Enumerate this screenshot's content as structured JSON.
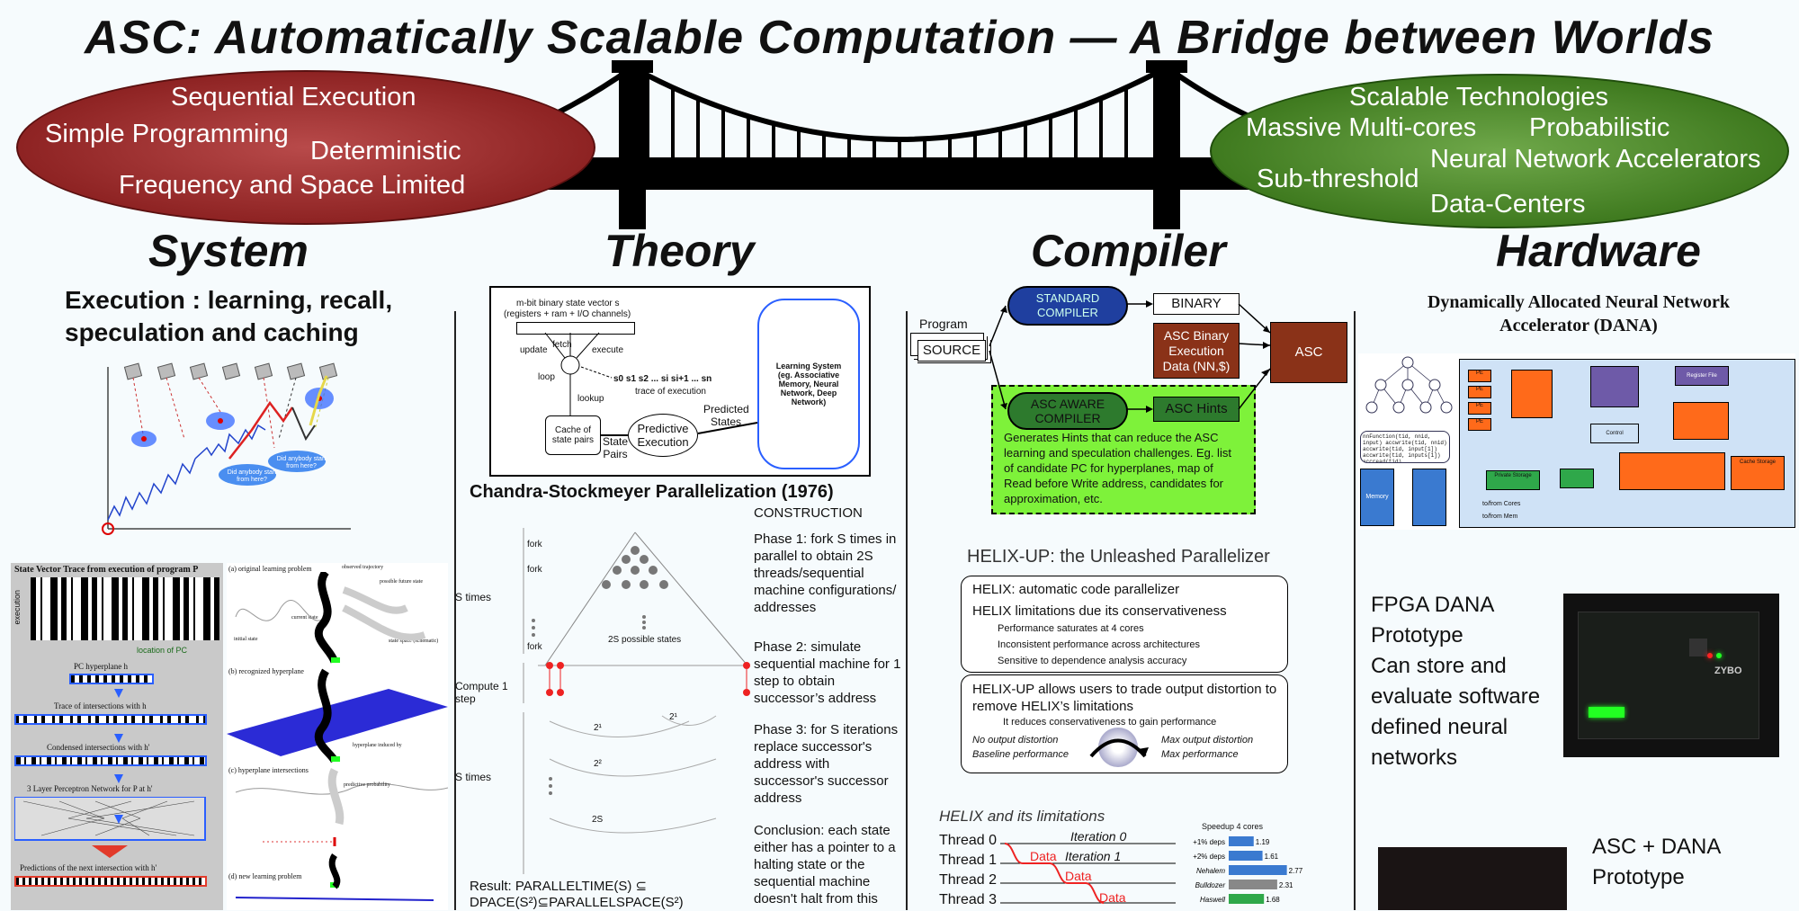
{
  "title": "ASC: Automatically Scalable Computation — A Bridge between Worlds",
  "left_oval": {
    "lines": [
      "Sequential Execution",
      "Simple Programming",
      "Deterministic",
      "Frequency and Space Limited"
    ]
  },
  "right_oval": {
    "lines": [
      "Scalable Technologies",
      "Massive Multi-cores",
      "Probabilistic",
      "Neural Network Accelerators",
      "Sub-threshold",
      "Data-Centers"
    ]
  },
  "sections": {
    "system": "System",
    "theory": "Theory",
    "compiler": "Compiler",
    "hardware": "Hardware"
  },
  "system": {
    "heading_line1": "Execution :  learning, recall,",
    "heading_line2": "speculation and caching",
    "bubble1": "Did anybody start from here?",
    "bubble2": "Did anybody start from here?",
    "trace": {
      "title": "State Vector Trace from execution of program P",
      "axis": "execution",
      "location_pc": "location of PC",
      "pc_hyperplane": "PC hyperplane h",
      "trace_intersections": "Trace of intersections with h",
      "condensed": "Condensed intersections with h'",
      "perceptron": "3 Layer Perceptron Network for P at h'",
      "predictions": "Predictions of the next intersection with h'"
    },
    "panels": {
      "a": "(a) original learning problem",
      "b": "(b) recognized hyperplane",
      "c": "(c) hyperplane intersections",
      "d": "(d) new learning problem",
      "observed": "observed trajectory",
      "possible_future": "possible future state",
      "initial": "initial state",
      "current": "current state",
      "state_space": "state space (schematic)",
      "hyperplane_induced": "hyperplane induced by",
      "predictive": "predictive probability"
    }
  },
  "theory": {
    "diagram": {
      "state_vector": "m-bit binary state vector s",
      "registers": "(registers + ram + I/O channels)",
      "update": "update",
      "fetch": "fetch",
      "execute": "execute",
      "loop": "loop",
      "sequence": "s0 s1 s2 ... si si+1 ... sn",
      "trace": "trace of execution",
      "lookup": "lookup",
      "cache": "Cache of state pairs",
      "predictive": "Predictive Execution",
      "predicted": "Predicted States",
      "state_pairs": "State Pairs",
      "learning_system": "Learning System (eg. Associative Memory, Neural Network, Deep Network)"
    },
    "chandra_title": "Chandra-Stockmeyer Parallelization (1976)",
    "construction": "CONSTRUCTION",
    "phase1": "Phase 1: fork S times in parallel to obtain 2S threads/sequential machine configurations/ addresses",
    "phase2": "Phase 2: simulate sequential machine for 1 step to obtain successor’s address",
    "phase3": "Phase 3: for S iterations replace successor's address with successor's successor address",
    "conclusion": "Conclusion: each state either has a pointer to a halting state or the sequential machine doesn't halt from this",
    "result_line1": "Result:  PARALLELTIME(S) ⊆",
    "result_line2": "DPACE(S²)⊆PARALLELSPACE(S²)",
    "tree": {
      "s_times": "S times",
      "fork": "fork",
      "possible_states": "2S possible states",
      "compute": "Compute 1 step",
      "s_times2": "S times",
      "p1": "2¹",
      "p2": "2¹",
      "p3": "2²",
      "p4": "2S"
    }
  },
  "compiler": {
    "program": "Program",
    "source": "SOURCE",
    "standard": "STANDARD COMPILER",
    "binary": "BINARY",
    "asc_binary": "ASC Binary Execution Data (NN,$)",
    "asc": "ASC",
    "aware": "ASC AWARE COMPILER",
    "hints": "ASC Hints",
    "hints_desc": "Generates Hints that can reduce the ASC learning and speculation challenges. Eg. list of candidate PC for hyperplanes, map of Read before Write address, candidates for approximation, etc.",
    "helix_title": "HELIX-UP: the Unleashed Parallelizer",
    "helix_box1": {
      "b1": "HELIX: automatic code parallelizer",
      "b2": "HELIX limitations due its conservativeness",
      "s1": "Performance saturates at 4 cores",
      "s2": "Inconsistent performance across architectures",
      "s3": "Sensitive to dependence analysis accuracy"
    },
    "helix_box2": {
      "b1": "HELIX-UP allows users to trade output distortion to remove HELIX’s limitations",
      "s1": "It reduces conservativeness to gain performance",
      "left1": "No output distortion",
      "left2": "Baseline performance",
      "right1": "Max output distortion",
      "right2": "Max performance"
    },
    "limits_title": "HELIX and its limitations",
    "threads": [
      "Thread 0",
      "Thread 1",
      "Thread 2",
      "Thread 3"
    ],
    "iter0": "Iteration 0",
    "iter1": "Iteration 1",
    "data": "Data",
    "speedup_title": "Speedup 4 cores",
    "speedup": [
      {
        "label": "+1% deps",
        "value": 1.19,
        "text": "1.19"
      },
      {
        "label": "+2% deps",
        "value": 1.61,
        "text": "1.61"
      },
      {
        "label": "Nehalem",
        "value": 2.77,
        "text": "2.77"
      },
      {
        "label": "Bulldozer",
        "value": 2.31,
        "text": "2.31"
      },
      {
        "label": "Haswell",
        "value": 1.68,
        "text": "1.68"
      }
    ]
  },
  "hardware": {
    "dana_title_line1": "Dynamically Allocated Neural Network",
    "dana_title_line2": "Accelerator (DANA)",
    "diagram": {
      "memory": "Memory",
      "register_file": "Register File",
      "control": "Control",
      "private_storage": "Private Storage",
      "cache_storage": "Cache Storage",
      "to_from_cores": "to/from Cores",
      "to_from_mem": "to/from Mem",
      "entry": "Entry",
      "pe": "PE",
      "code": "nnFunction(tid, nnid, input) accwrite(tid, nnid) accwrite(tid, input[1]) accwrite(tid, inputs[1]) accread(tid)"
    },
    "fpga": [
      "FPGA DANA",
      "Prototype",
      "Can store and",
      "evaluate software",
      "defined neural",
      "networks"
    ],
    "asc_dana": [
      "ASC + DANA",
      "Prototype"
    ],
    "board_label": "ZYBO"
  },
  "colors": {
    "left_oval": "#8e2323",
    "right_oval": "#3f7a1f",
    "standard_compiler": "#1f3f9f",
    "aware_compiler": "#2d7a2d",
    "hints_box": "#7ef23a",
    "asc_box": "#8a3218",
    "hw_bg": "#cfe2f6",
    "orange": "#ff6a1a",
    "purple": "#6e5aa8",
    "green": "#2fa84a",
    "red": "#e23a2a"
  }
}
